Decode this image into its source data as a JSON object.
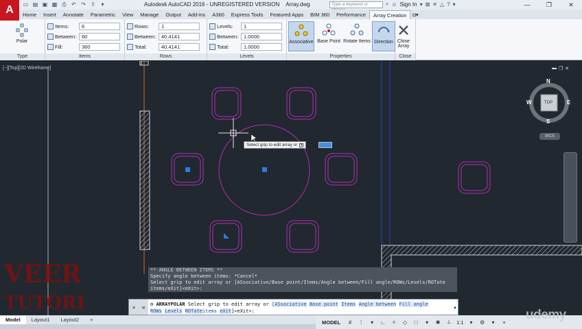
{
  "app": {
    "logo_letter": "A",
    "title": "Autodesk AutoCAD 2016 - UNREGISTERED VERSION",
    "file": "Array.dwg",
    "search_placeholder": "Type a keyword or phrase",
    "sign_in": "Sign In"
  },
  "ribbon_tabs": [
    "Home",
    "Insert",
    "Annotate",
    "Parametric",
    "View",
    "Manage",
    "Output",
    "Add-ins",
    "A360",
    "Express Tools",
    "Featured Apps",
    "BIM 360",
    "Performance",
    "Array Creation"
  ],
  "ribbon": {
    "type_panel": {
      "button": "Polar",
      "title": "Type"
    },
    "items_panel": {
      "title": "Items",
      "items_label": "Items:",
      "items_value": "6",
      "between_label": "Between:",
      "between_value": "60",
      "fill_label": "Fill:",
      "fill_value": "360"
    },
    "rows_panel": {
      "title": "Rows",
      "rows_label": "Rows:",
      "rows_value": "1",
      "between_label": "Between:",
      "between_value": "40.4141",
      "total_label": "Total:",
      "total_value": "40.4141"
    },
    "levels_panel": {
      "title": "Levels",
      "levels_label": "Levels:",
      "levels_value": "1",
      "between_label": "Between:",
      "between_value": "1.0000",
      "total_label": "Total:",
      "total_value": "1.0000"
    },
    "properties_panel": {
      "title": "Properties",
      "associative": "Associative",
      "base_point": "Base Point",
      "rotate_items": "Rotate Items",
      "direction": "Direction"
    },
    "close_panel": {
      "title": "Close",
      "close_label": "Close",
      "close_label2": "Array"
    }
  },
  "viewport": {
    "label": "[−][Top][2D Wireframe]",
    "viewcube_top": "TOP",
    "n": "N",
    "s": "S",
    "e": "E",
    "w": "W",
    "wcs": "WCS"
  },
  "tooltip": "Select grip to edit array or",
  "history": [
    "** ANGLE BETWEEN ITEMS **",
    "Specify angle between items: *Cancel*",
    "Select grip to edit array or [ASsociative/Base point/Items/Angle between/Fill angle/ROWs/Levels/ROTate",
    "items/eXit]<eXit>:"
  ],
  "command": {
    "name": "ARRAYPOLAR",
    "prompt": " Select grip to edit array or [",
    "opt_as": "ASsociative",
    "opt_base": "Base point",
    "opt_items": "Items",
    "opt_angle": "Angle between",
    "opt_fill": "Fill angle",
    "opt_rows": "ROWs",
    "opt_levels": "Levels",
    "opt_rot": "ROTate",
    "opt_items2": "items",
    "opt_exit": "eXit",
    "tail": "]<eXit>:"
  },
  "layout_tabs": [
    "Model",
    "Layout1",
    "Layout2",
    "+"
  ],
  "status": {
    "model": "MODEL",
    "scale": "1:1"
  },
  "branding": {
    "udemy": "udemy",
    "watermark_line1": "VEER",
    "watermark_line2": "TUTORIAL"
  },
  "colors": {
    "canvas": "#212830",
    "magenta": "#b22fb2",
    "grip": "#2d7be0",
    "accent": "#c8161e"
  }
}
